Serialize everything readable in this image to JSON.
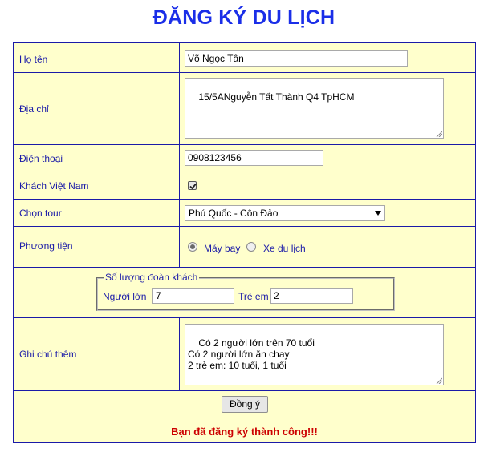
{
  "page": {
    "title": "ĐĂNG KÝ DU LỊCH"
  },
  "form": {
    "fullname": {
      "label": "Họ tên",
      "value": "Võ Ngọc Tân"
    },
    "address": {
      "label": "Địa chỉ",
      "value": "15/5ANguyễn Tất Thành Q4 TpHCM"
    },
    "phone": {
      "label": "Điện thoại",
      "value": "0908123456"
    },
    "vietnamese_guest": {
      "label": "Khách Việt Nam",
      "checked": true
    },
    "tour": {
      "label": "Chọn tour",
      "selected": "Phú Quốc - Côn Đảo"
    },
    "transport": {
      "label": "Phương tiện",
      "options": [
        {
          "label": "Máy bay",
          "selected": true
        },
        {
          "label": "Xe du lịch",
          "selected": false
        }
      ]
    },
    "group": {
      "legend": "Số lượng đoàn khách",
      "adults_label": "Người lớn",
      "adults_value": "7",
      "children_label": "Trẻ em",
      "children_value": "2"
    },
    "notes": {
      "label": "Ghi chú thêm",
      "value": "Có 2 người lớn trên 70 tuổi\nCó 2 người lớn ăn chay\n2 trẻ em: 10 tuổi, 1 tuổi"
    },
    "submit_label": "Đồng ý",
    "result_message": "Bạn đã đăng ký thành công!!!"
  }
}
